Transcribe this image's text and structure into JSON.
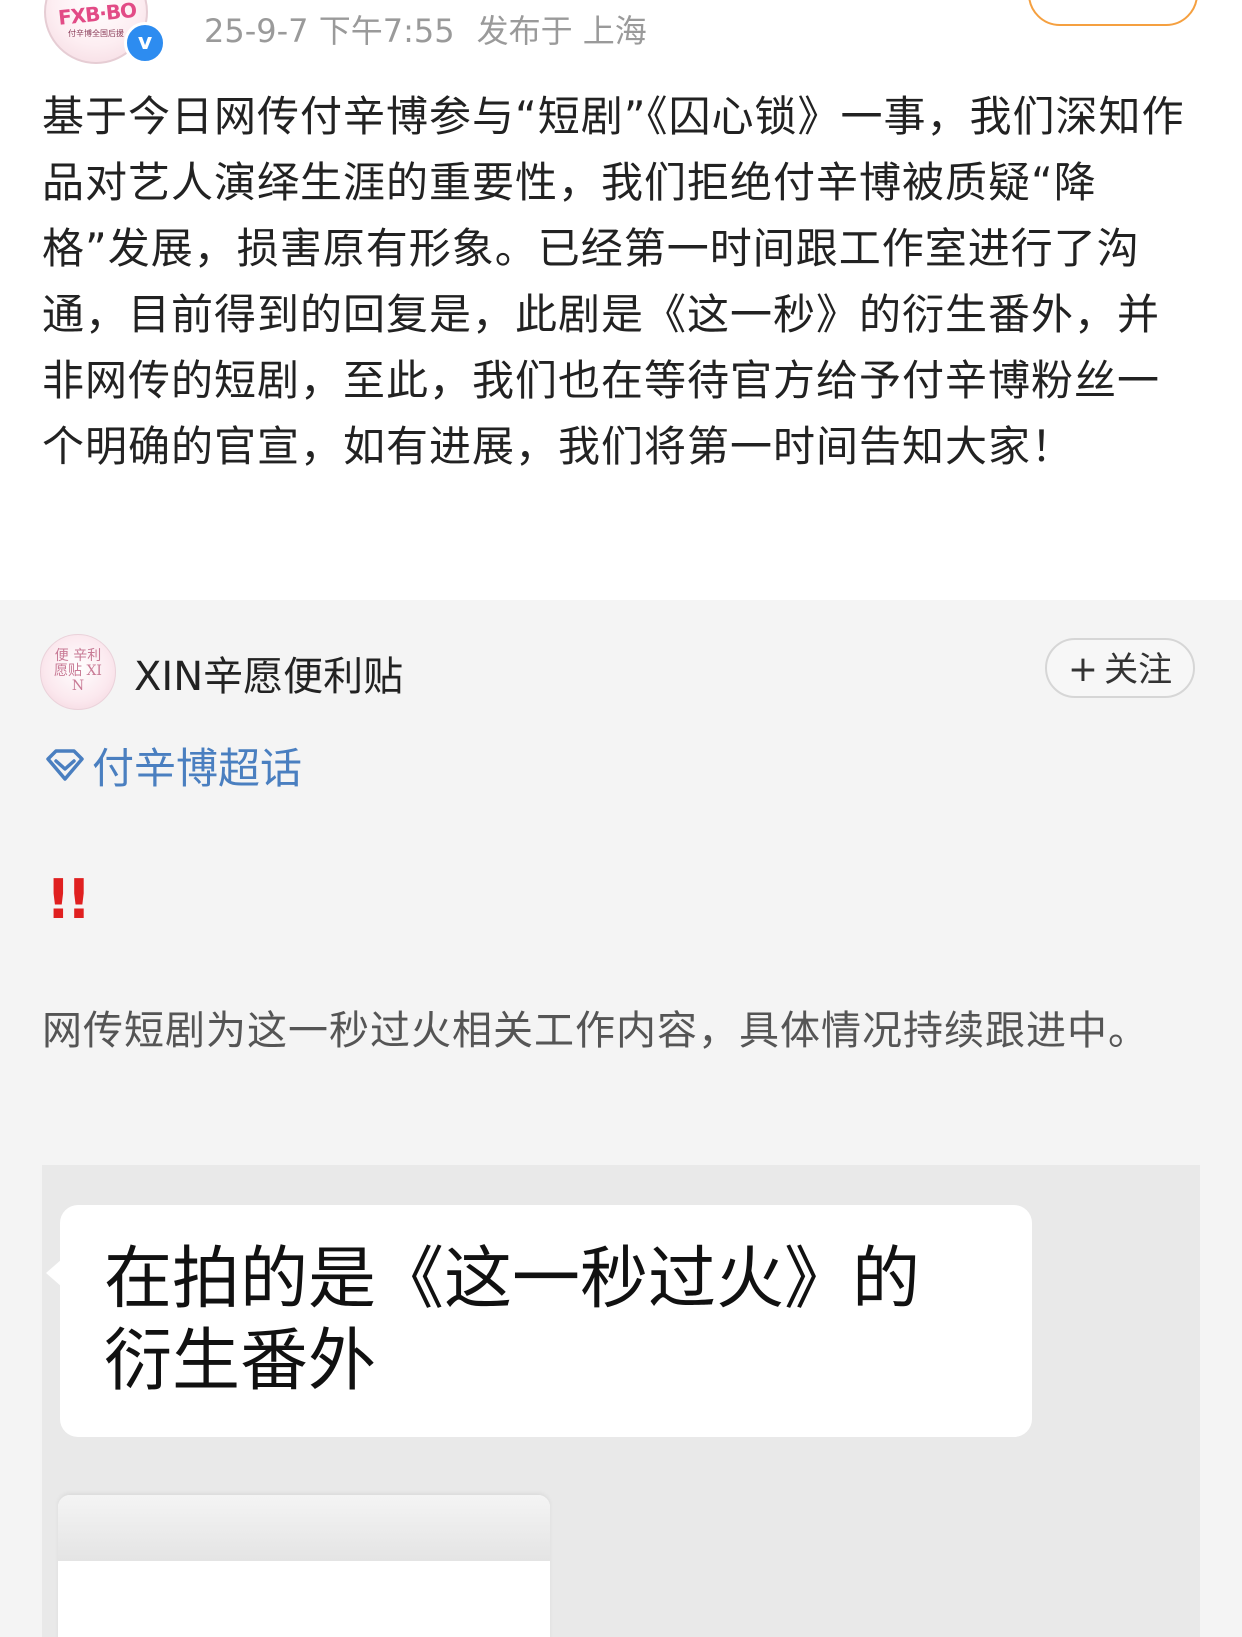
{
  "post": {
    "avatar_logo": "FXB·BO",
    "avatar_sub": "付辛博全国后援",
    "verified_mark": "v",
    "date": "25-9-7 下午7:55",
    "location": "发布于 上海",
    "body": "基于今日网传付辛博参与“短剧”《囚心锁》一事，我们深知作品对艺人演绎生涯的重要性，我们拒绝付辛博被质疑“降格”发展，损害原有形象。已经第一时间跟工作室进行了沟通，目前得到的回复是，此剧是《这一秒》的衍生番外，并非网传的短剧，至此，我们也在等待官方给予付辛博粉丝一个明确的官宣，如有进展，我们将第一时间告知大家！"
  },
  "repost": {
    "avatar_text": "便 辛利 愿贴 XIN",
    "username": "XIN辛愿便利贴",
    "follow_plus": "+",
    "follow_label": "关注",
    "topic": "付辛博超话",
    "topic_icon": "supertopic-diamond-icon",
    "alert": "!!",
    "text": "网传短剧为这一秒过火相关工作内容，具体情况持续跟进中。",
    "image_caption": "在拍的是《这一秒过火》的衍生番外"
  },
  "colors": {
    "link": "#4a7fc0",
    "alert": "#e02020",
    "verified": "#2d8cf0",
    "repost_bg": "#f4f4f4"
  }
}
